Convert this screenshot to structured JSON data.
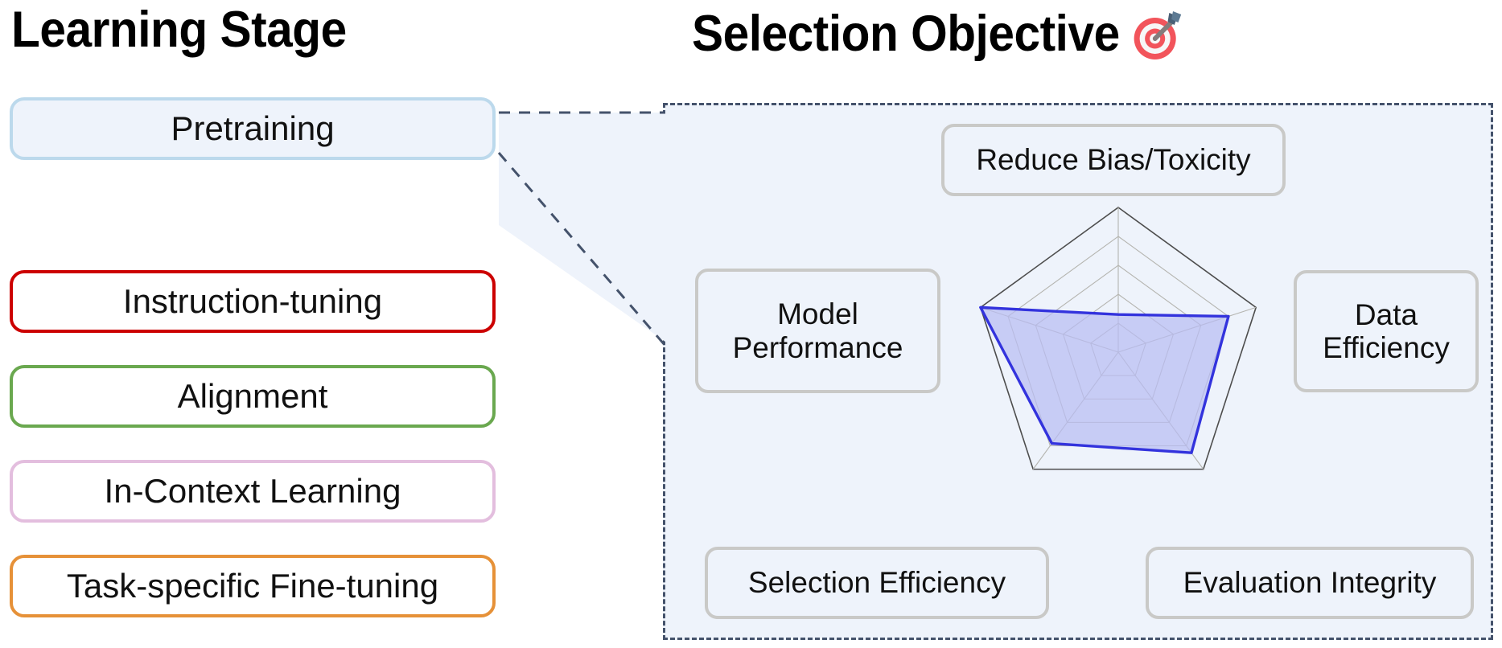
{
  "headings": {
    "left": "Learning Stage",
    "right": "Selection Objective",
    "right_icon": "dart-target-emoji"
  },
  "learning_stages": {
    "items": [
      {
        "label": "Pretraining",
        "border_color": "#bcd9ec",
        "fill_color": "#eef3fb",
        "selected": true
      },
      {
        "label": "Instruction-tuning",
        "border_color": "#cc0000",
        "fill_color": "#ffffff",
        "selected": false
      },
      {
        "label": "Alignment",
        "border_color": "#6aa84f",
        "fill_color": "#ffffff",
        "selected": false
      },
      {
        "label": "In-Context Learning",
        "border_color": "#e3bede",
        "fill_color": "#ffffff",
        "selected": false
      },
      {
        "label": "Task-specific Fine-tuning",
        "border_color": "#e69138",
        "fill_color": "#ffffff",
        "selected": false
      }
    ]
  },
  "objective_panel": {
    "border_color": "#44526b",
    "background_color": "#eef3fb",
    "label_border_color": "#c9c9c7",
    "labels": [
      {
        "text": "Reduce Bias/Toxicity",
        "lines": [
          "Reduce Bias/Toxicity"
        ]
      },
      {
        "text": "Data Efficiency",
        "lines": [
          "Data",
          "Efficiency"
        ]
      },
      {
        "text": "Evaluation Integrity",
        "lines": [
          "Evaluation Integrity"
        ]
      },
      {
        "text": "Selection Efficiency",
        "lines": [
          "Selection Efficiency"
        ]
      },
      {
        "text": "Model Performance",
        "lines": [
          "Model",
          "Performance"
        ]
      }
    ]
  },
  "chart_data": {
    "type": "radar",
    "title": "Selection Objective",
    "categories": [
      "Reduce Bias/Toxicity",
      "Data Efficiency",
      "Evaluation Integrity",
      "Selection Efficiency",
      "Model Performance"
    ],
    "series": [
      {
        "name": "Pretraining",
        "values": [
          1.3,
          4.0,
          4.3,
          3.9,
          5.0
        ],
        "line_color": "#3333dd",
        "fill_color": "#b9bdf2"
      }
    ],
    "rmax": 5,
    "rings": 5,
    "outer_ring_color": "#4d4d4d",
    "grid_color": "#b5b5b0",
    "grid": true,
    "legend": "none"
  }
}
